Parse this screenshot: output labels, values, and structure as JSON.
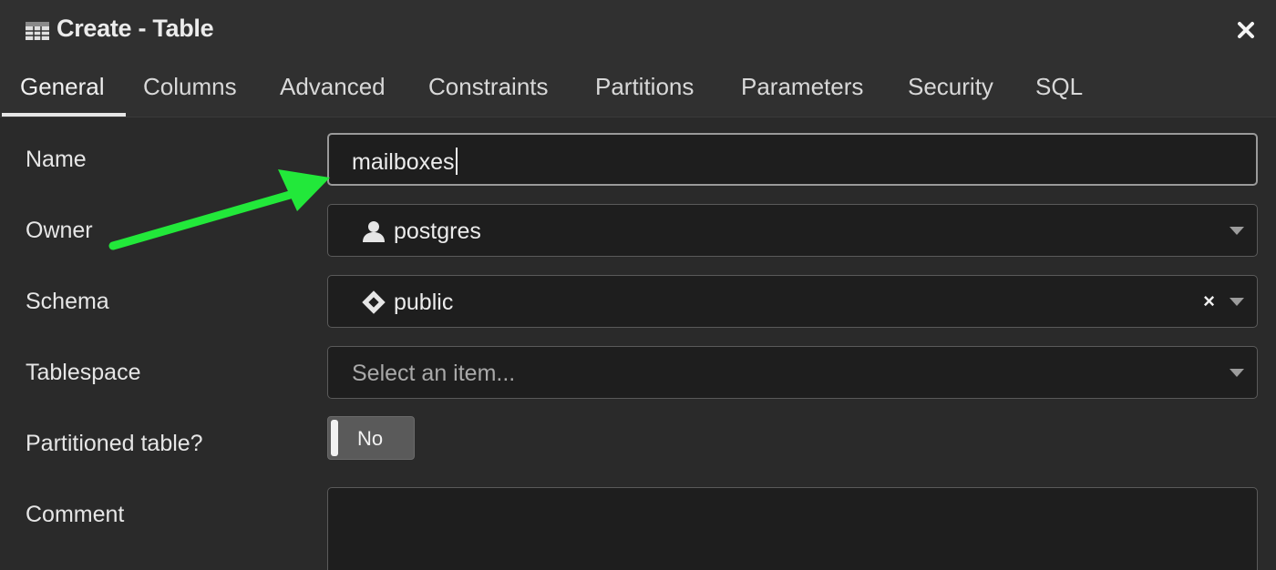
{
  "dialog": {
    "title": "Create - Table",
    "close_icon": "close-icon",
    "title_icon": "table-icon"
  },
  "tabs": [
    {
      "label": "General",
      "active": true
    },
    {
      "label": "Columns"
    },
    {
      "label": "Advanced"
    },
    {
      "label": "Constraints"
    },
    {
      "label": "Partitions"
    },
    {
      "label": "Parameters"
    },
    {
      "label": "Security"
    },
    {
      "label": "SQL"
    }
  ],
  "form": {
    "name": {
      "label": "Name",
      "value": "mailboxes"
    },
    "owner": {
      "label": "Owner",
      "value": "postgres",
      "icon": "user-icon"
    },
    "schema": {
      "label": "Schema",
      "value": "public",
      "icon": "schema-icon",
      "clear": "×"
    },
    "tablespace": {
      "label": "Tablespace",
      "placeholder": "Select an item..."
    },
    "partitioned": {
      "label": "Partitioned table?",
      "value": "No"
    },
    "comment": {
      "label": "Comment",
      "value": ""
    }
  },
  "colors": {
    "annotation_arrow": "#22e83a",
    "background": "#2a2a2a",
    "field_background": "#1e1e1e"
  }
}
